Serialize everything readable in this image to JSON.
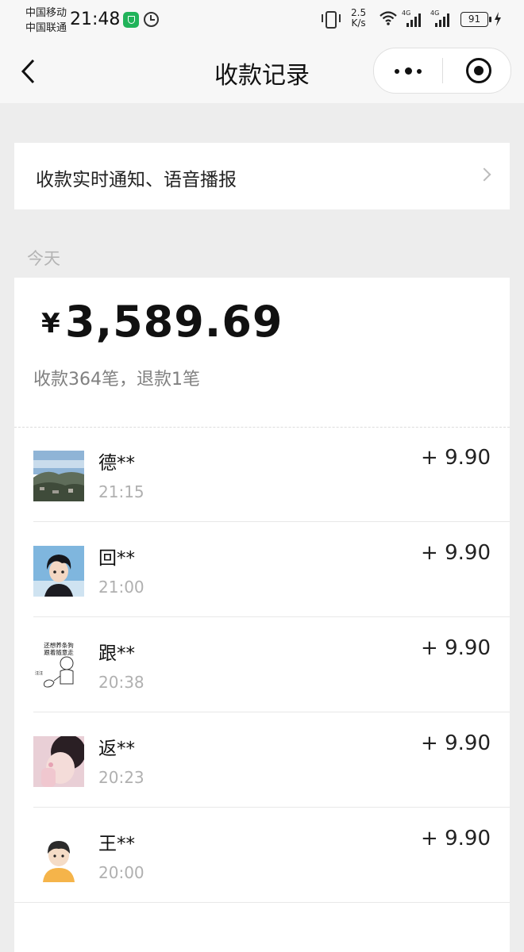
{
  "status_bar": {
    "carrier_1": "中国移动",
    "carrier_2": "中国联通",
    "time": "21:48",
    "net_speed_value": "2.5",
    "net_speed_unit": "K/s",
    "network_1": "4G",
    "network_2": "4G",
    "battery": "91",
    "icons": [
      "shield-icon",
      "alarm-icon",
      "vibrate-icon",
      "wifi-icon",
      "signal-icon",
      "signal-icon",
      "battery-icon",
      "charging-icon"
    ]
  },
  "nav": {
    "title": "收款记录",
    "icons": [
      "back-icon",
      "more-icon",
      "close-target-icon"
    ]
  },
  "notify": {
    "label": "收款实时通知、语音播报"
  },
  "date_label": "今天",
  "summary": {
    "currency": "¥",
    "total": "3,589.69",
    "counts": "收款364笔，退款1笔"
  },
  "records": [
    {
      "name": "德**",
      "time": "21:15",
      "amount": "+ 9.90",
      "avatar": "landscape"
    },
    {
      "name": "回**",
      "time": "21:00",
      "amount": "+ 9.90",
      "avatar": "anime-boy"
    },
    {
      "name": "跟**",
      "time": "20:38",
      "amount": "+ 9.90",
      "avatar": "meme"
    },
    {
      "name": "返**",
      "time": "20:23",
      "amount": "+ 9.90",
      "avatar": "photo"
    },
    {
      "name": "王**",
      "time": "20:00",
      "amount": "+ 9.90",
      "avatar": "cartoon-boy"
    }
  ],
  "avatar_text": {
    "meme_line1": "还想养条狗",
    "meme_line2": "跟着随意走",
    "meme_tag": "汪汪"
  },
  "colors": {
    "background": "#ededed",
    "card": "#ffffff",
    "text_primary": "#111111",
    "text_secondary": "#808080",
    "text_muted": "#b0b0b0",
    "shield_green": "#21b35a"
  }
}
